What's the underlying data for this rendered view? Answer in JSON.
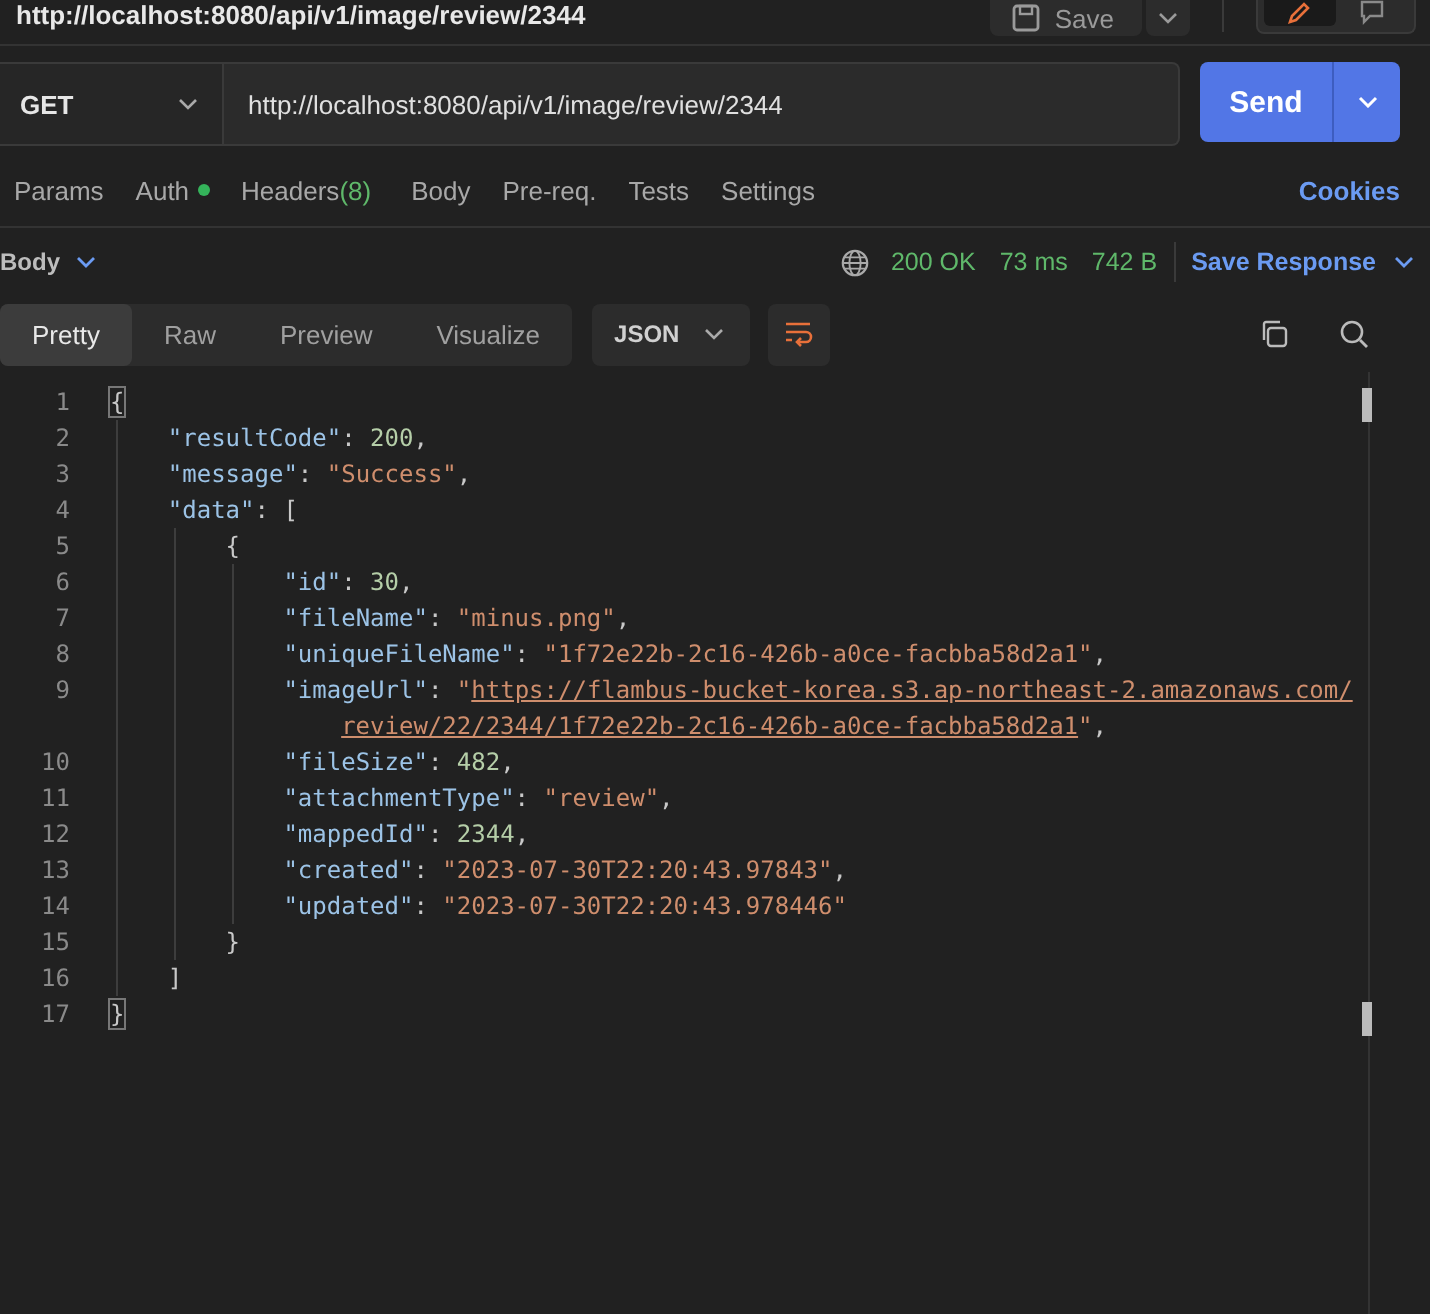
{
  "header": {
    "title": "http://localhost:8080/api/v1/image/review/2344",
    "save_label": "Save"
  },
  "request": {
    "method": "GET",
    "url": "http://localhost:8080/api/v1/image/review/2344",
    "send_label": "Send"
  },
  "request_tabs": [
    {
      "label": "Params",
      "dot": false
    },
    {
      "label": "Auth",
      "dot": true
    },
    {
      "label": "Headers",
      "count": "(8)",
      "dot": false
    },
    {
      "label": "Body",
      "dot": false
    },
    {
      "label": "Pre-req.",
      "dot": false
    },
    {
      "label": "Tests",
      "dot": false
    },
    {
      "label": "Settings",
      "dot": false
    }
  ],
  "cookies_link": "Cookies",
  "response": {
    "section": "Body",
    "status": "200 OK",
    "time": "73 ms",
    "size": "742 B",
    "save_response": "Save Response"
  },
  "view_tabs": [
    {
      "label": "Pretty",
      "selected": true
    },
    {
      "label": "Raw",
      "selected": false
    },
    {
      "label": "Preview",
      "selected": false
    },
    {
      "label": "Visualize",
      "selected": false
    }
  ],
  "format": "JSON",
  "code_lines": [
    {
      "number": "1",
      "tokens": [
        {
          "kind": "bracket-match",
          "text": "{"
        }
      ]
    },
    {
      "number": "2",
      "tokens": [
        {
          "kind": "key",
          "text": "    \"resultCode\""
        },
        {
          "kind": "punct",
          "text": ": "
        },
        {
          "kind": "number",
          "text": "200"
        },
        {
          "kind": "punct",
          "text": ","
        }
      ]
    },
    {
      "number": "3",
      "tokens": [
        {
          "kind": "key",
          "text": "    \"message\""
        },
        {
          "kind": "punct",
          "text": ": "
        },
        {
          "kind": "string",
          "text": "\"Success\""
        },
        {
          "kind": "punct",
          "text": ","
        }
      ]
    },
    {
      "number": "4",
      "tokens": [
        {
          "kind": "key",
          "text": "    \"data\""
        },
        {
          "kind": "punct",
          "text": ": ["
        }
      ]
    },
    {
      "number": "5",
      "tokens": [
        {
          "kind": "punct",
          "text": "        {"
        }
      ]
    },
    {
      "number": "6",
      "tokens": [
        {
          "kind": "key",
          "text": "            \"id\""
        },
        {
          "kind": "punct",
          "text": ": "
        },
        {
          "kind": "number",
          "text": "30"
        },
        {
          "kind": "punct",
          "text": ","
        }
      ]
    },
    {
      "number": "7",
      "tokens": [
        {
          "kind": "key",
          "text": "            \"fileName\""
        },
        {
          "kind": "punct",
          "text": ": "
        },
        {
          "kind": "string",
          "text": "\"minus.png\""
        },
        {
          "kind": "punct",
          "text": ","
        }
      ]
    },
    {
      "number": "8",
      "tokens": [
        {
          "kind": "key",
          "text": "            \"uniqueFileName\""
        },
        {
          "kind": "punct",
          "text": ": "
        },
        {
          "kind": "string",
          "text": "\"1f72e22b-2c16-426b-a0ce-facbba58d2a1\""
        },
        {
          "kind": "punct",
          "text": ","
        }
      ]
    },
    {
      "number": "9",
      "tokens": [
        {
          "kind": "key",
          "text": "            \"imageUrl\""
        },
        {
          "kind": "punct",
          "text": ": "
        },
        {
          "kind": "string",
          "text": "\""
        },
        {
          "kind": "link",
          "text": "https://flambus-bucket-korea.s3.ap-northeast-2.amazonaws.com/"
        }
      ]
    },
    {
      "tokens": [
        {
          "kind": "link",
          "text": "review/22/2344/1f72e22b-2c16-426b-a0ce-facbba58d2a1"
        },
        {
          "kind": "string",
          "text": "\""
        },
        {
          "kind": "punct",
          "text": ","
        }
      ]
    },
    {
      "number": "10",
      "tokens": [
        {
          "kind": "key",
          "text": "            \"fileSize\""
        },
        {
          "kind": "punct",
          "text": ": "
        },
        {
          "kind": "number",
          "text": "482"
        },
        {
          "kind": "punct",
          "text": ","
        }
      ]
    },
    {
      "number": "11",
      "tokens": [
        {
          "kind": "key",
          "text": "            \"attachmentType\""
        },
        {
          "kind": "punct",
          "text": ": "
        },
        {
          "kind": "string",
          "text": "\"review\""
        },
        {
          "kind": "punct",
          "text": ","
        }
      ]
    },
    {
      "number": "12",
      "tokens": [
        {
          "kind": "key",
          "text": "            \"mappedId\""
        },
        {
          "kind": "punct",
          "text": ": "
        },
        {
          "kind": "number",
          "text": "2344"
        },
        {
          "kind": "punct",
          "text": ","
        }
      ]
    },
    {
      "number": "13",
      "tokens": [
        {
          "kind": "key",
          "text": "            \"created\""
        },
        {
          "kind": "punct",
          "text": ": "
        },
        {
          "kind": "string",
          "text": "\"2023-07-30T22:20:43.97843\""
        },
        {
          "kind": "punct",
          "text": ","
        }
      ]
    },
    {
      "number": "14",
      "tokens": [
        {
          "kind": "key",
          "text": "            \"updated\""
        },
        {
          "kind": "punct",
          "text": ": "
        },
        {
          "kind": "string",
          "text": "\"2023-07-30T22:20:43.978446\""
        }
      ]
    },
    {
      "number": "15",
      "tokens": [
        {
          "kind": "punct",
          "text": "        }"
        }
      ]
    },
    {
      "number": "16",
      "tokens": [
        {
          "kind": "punct",
          "text": "    ]"
        }
      ]
    },
    {
      "number": "17",
      "tokens": [
        {
          "kind": "bracket-match",
          "text": "}"
        }
      ]
    }
  ]
}
